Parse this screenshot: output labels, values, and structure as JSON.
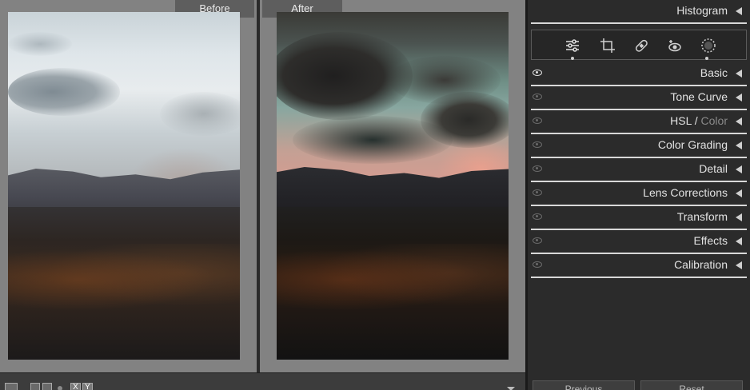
{
  "compare": {
    "before_label": "Before",
    "after_label": "After"
  },
  "panel": {
    "histogram": "Histogram",
    "tools": [
      "edit-sliders-icon",
      "crop-icon",
      "healing-bandaid-icon",
      "red-eye-icon",
      "masking-icon"
    ],
    "sections": [
      {
        "id": "basic",
        "label": "Basic",
        "eye_on": true
      },
      {
        "id": "tone-curve",
        "label": "Tone Curve",
        "eye_on": false
      },
      {
        "id": "hsl",
        "label": "HSL",
        "label_dim": "Color",
        "eye_on": false
      },
      {
        "id": "color-grading",
        "label": "Color Grading",
        "eye_on": false
      },
      {
        "id": "detail",
        "label": "Detail",
        "eye_on": false
      },
      {
        "id": "lens-corrections",
        "label": "Lens Corrections",
        "eye_on": false
      },
      {
        "id": "transform",
        "label": "Transform",
        "eye_on": false
      },
      {
        "id": "effects",
        "label": "Effects",
        "eye_on": false
      },
      {
        "id": "calibration",
        "label": "Calibration",
        "eye_on": false
      }
    ],
    "previous_button": "Previous",
    "reset_button": "Reset"
  },
  "toolbar": {
    "swap_x_label": "X",
    "swap_y_label": "Y"
  }
}
